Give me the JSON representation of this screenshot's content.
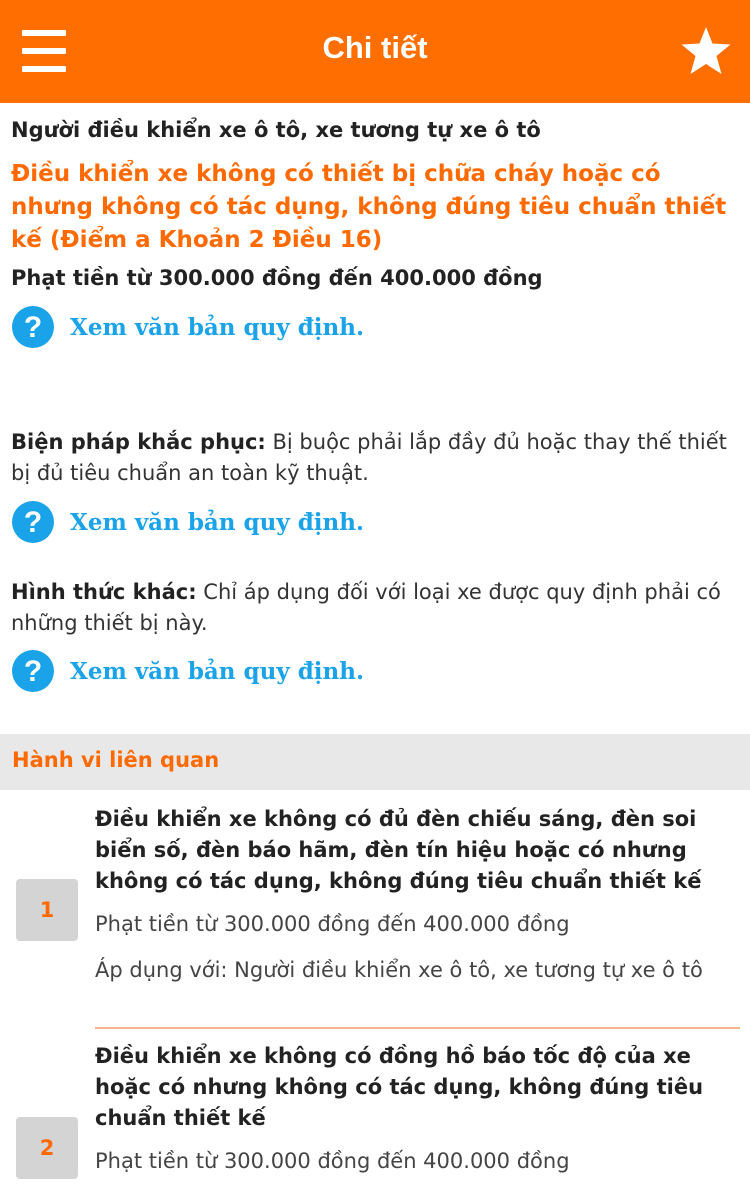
{
  "header": {
    "title": "Chi tiết",
    "menu_icon": "hamburger-menu-icon",
    "favorite_icon": "star-icon"
  },
  "detail": {
    "subject": "Người điều khiển xe ô tô, xe tương tự xe ô tô",
    "violation": "Điều khiển xe không có thiết bị chữa cháy hoặc có nhưng không có tác dụng, không đúng tiêu chuẩn thiết kế (Điểm a Khoản 2 Điều 16)",
    "fine": "Phạt tiền từ 300.000 đồng đến 400.000 đồng",
    "remedy_label": "Biện pháp khắc phục:",
    "remedy_text": " Bị buộc phải lắp đầy đủ hoặc thay thế thiết bị đủ tiêu chuẩn an toàn kỹ thuật.",
    "other_label": "Hình thức khác:",
    "other_text": " Chỉ áp dụng đối với loại xe được quy định phải có những thiết bị này.",
    "link_text": "Xem văn bản quy định."
  },
  "related": {
    "header": "Hành vi liên quan",
    "items": [
      {
        "number": "1",
        "title": "Điều khiển xe không có đủ đèn chiếu sáng, đèn soi biển số, đèn báo hãm, đèn tín hiệu hoặc có nhưng không có tác dụng, không đúng tiêu chuẩn thiết kế",
        "fine": "Phạt tiền từ 300.000 đồng đến 400.000 đồng",
        "apply": "Áp dụng với: Người điều khiển xe ô tô, xe tương tự xe ô tô"
      },
      {
        "number": "2",
        "title": "Điều khiển xe không có đồng hồ báo tốc độ của xe hoặc có nhưng không có tác dụng, không đúng tiêu chuẩn thiết kế",
        "fine": "Phạt tiền từ 300.000 đồng đến 400.000 đồng"
      }
    ]
  },
  "colors": {
    "accent": "#ff6e00",
    "link": "#1aa3e8",
    "section_bg": "#e8e8e8"
  }
}
